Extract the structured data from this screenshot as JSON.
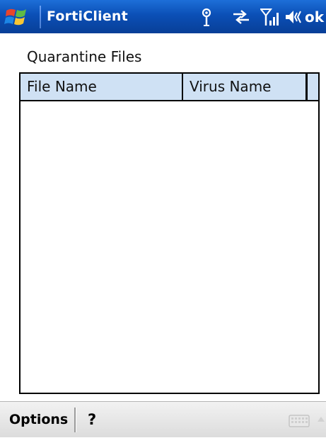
{
  "titlebar": {
    "app_title": "FortiClient",
    "ok_label": "ok",
    "icons": [
      "windows-flag-icon",
      "antenna-icon",
      "sync-arrows-icon",
      "signal-strength-icon",
      "volume-icon"
    ]
  },
  "main": {
    "title": "Quarantine Files",
    "table": {
      "columns": [
        "File Name",
        "Virus Name"
      ],
      "rows": []
    }
  },
  "softbar": {
    "left_label": "Options",
    "right_label": "?",
    "icons": [
      "keyboard-icon",
      "up-arrow-icon"
    ]
  },
  "colors": {
    "titlebar": "#0b4fb6",
    "header_bg": "#cfe1f4",
    "softbar": "#dcdcdc"
  }
}
